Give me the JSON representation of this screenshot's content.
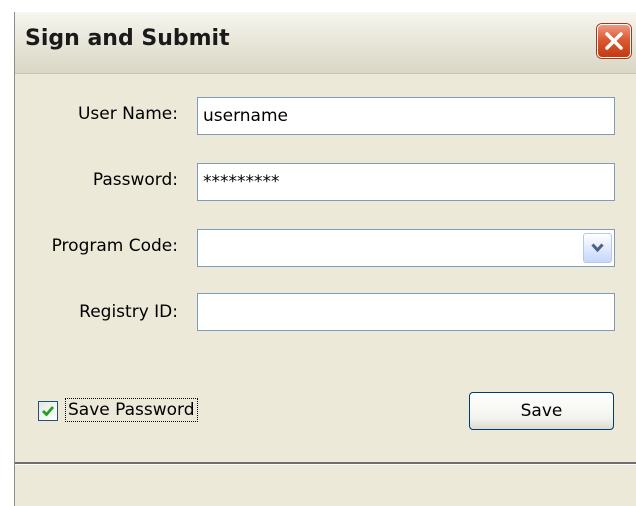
{
  "window": {
    "title": "Sign and Submit",
    "close_icon": "close-icon"
  },
  "form": {
    "username": {
      "label": "User Name:",
      "value": "username"
    },
    "password": {
      "label": "Password:",
      "value": "*********"
    },
    "program_code": {
      "label": "Program Code:",
      "value": "",
      "dropdown_icon": "chevron-down-icon"
    },
    "registry_id": {
      "label": "Registry ID:",
      "value": ""
    },
    "save_password": {
      "label": "Save Password",
      "checked": true
    },
    "save_button": {
      "label": "Save"
    }
  },
  "colors": {
    "dialog_bg": "#ece9d8",
    "close_button": "#dc5a32",
    "field_border": "#7f9db9",
    "check_mark": "#21a121"
  }
}
